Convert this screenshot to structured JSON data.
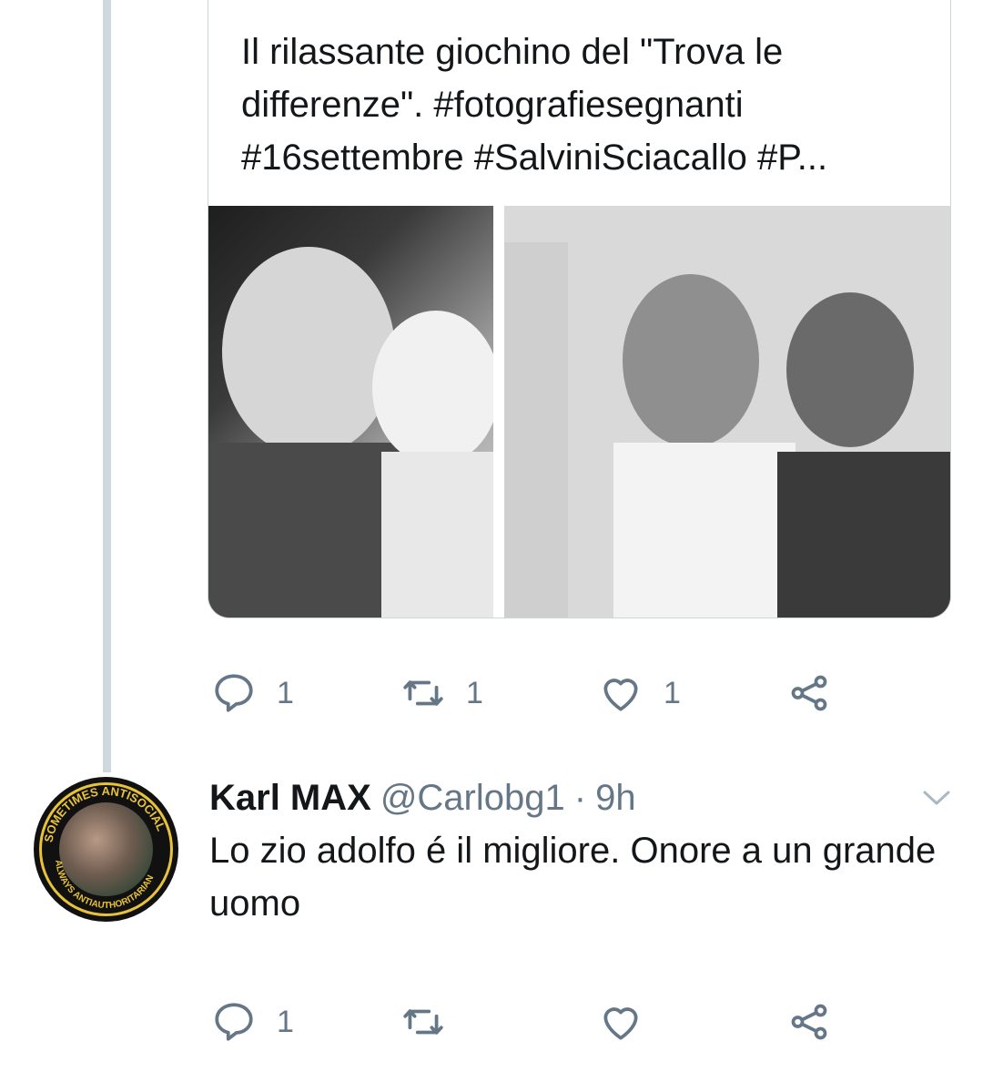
{
  "quoted_tweet": {
    "text": "Il rilassante giochino del \"Trova le\ndifferenze\". #fotografiesegnanti\n#16settembre #SalviniSciacallo #P..."
  },
  "quoted_actions": {
    "reply_count": "1",
    "retweet_count": "1",
    "like_count": "1"
  },
  "reply": {
    "display_name": "Karl MAX",
    "handle": "@Carlobg1",
    "separator": "·",
    "time": "9h",
    "text": "Lo zio adolfo é il migliore. Onore a un grande uomo",
    "avatar_text_top": "SOMETIMES ANTISOCIAL",
    "avatar_text_bottom": "ALWAYS ANTIAUTHORITARIAN"
  },
  "reply_actions": {
    "reply_count": "1",
    "retweet_count": "",
    "like_count": ""
  },
  "colors": {
    "text": "#14171a",
    "secondary": "#657786",
    "thread_line": "#cfd8de",
    "border": "#ccd6dd"
  },
  "icons": [
    "reply-icon",
    "retweet-icon",
    "like-icon",
    "share-icon",
    "chevron-down-icon"
  ]
}
